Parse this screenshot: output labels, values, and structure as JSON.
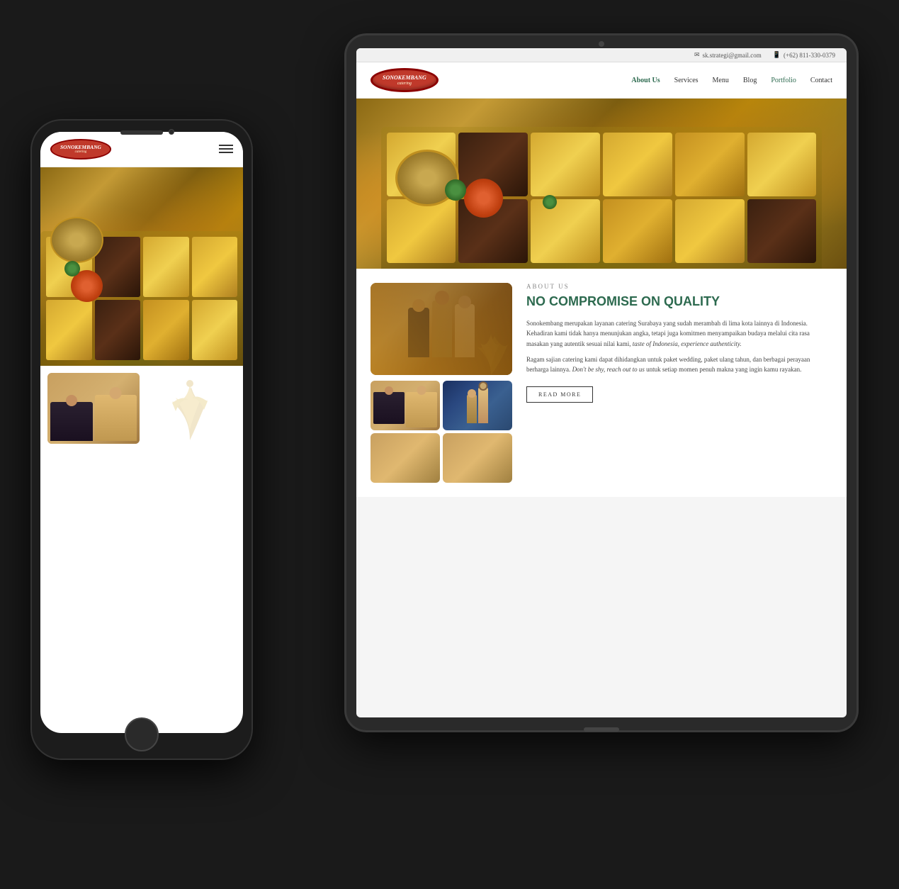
{
  "tablet": {
    "topbar": {
      "email_icon": "✉",
      "email": "sk.strategi@gmail.com",
      "phone_icon": "📱",
      "phone": "(+62) 811-330-0379"
    },
    "nav": {
      "logo": "SONOKEMBANG",
      "logo_sub": "catering",
      "links": [
        "About Us",
        "Services",
        "Menu",
        "Blog",
        "Portfolio",
        "Contact"
      ],
      "active_link": "About Us"
    },
    "hero": {
      "alt": "Catering food display with yellow cheese sauce over meat in aluminum tray with garnish"
    },
    "about": {
      "label": "ABOUT US",
      "title": "NO COMPROMISE ON QUALITY",
      "body1": "Sonokembang merupakan layanan catering Surabaya yang sudah merambah di lima kota lainnya di Indonesia. Kehadiran kami tidak hanya menunjukan angka, tetapi juga komitmen menyampaikan budaya melalui cita rasa masakan yang autentik sesuai nilai kami,",
      "body1_italic": "taste of Indonesia, experience authenticity.",
      "body2": "Ragam sajian catering kami dapat dihidangkan untuk paket wedding, paket ulang tahun, dan berbagai perayaan berharga lainnya.",
      "body2_italic": "Don't be shy, reach out to us",
      "body2_end": "untuk setiap momen penuh makna yang ingin kamu rayakan.",
      "read_more": "READ MORE"
    }
  },
  "phone": {
    "nav": {
      "logo": "SONOKEMBANG",
      "logo_sub": "catering"
    },
    "hero": {
      "alt": "Catering food display mobile view"
    }
  }
}
